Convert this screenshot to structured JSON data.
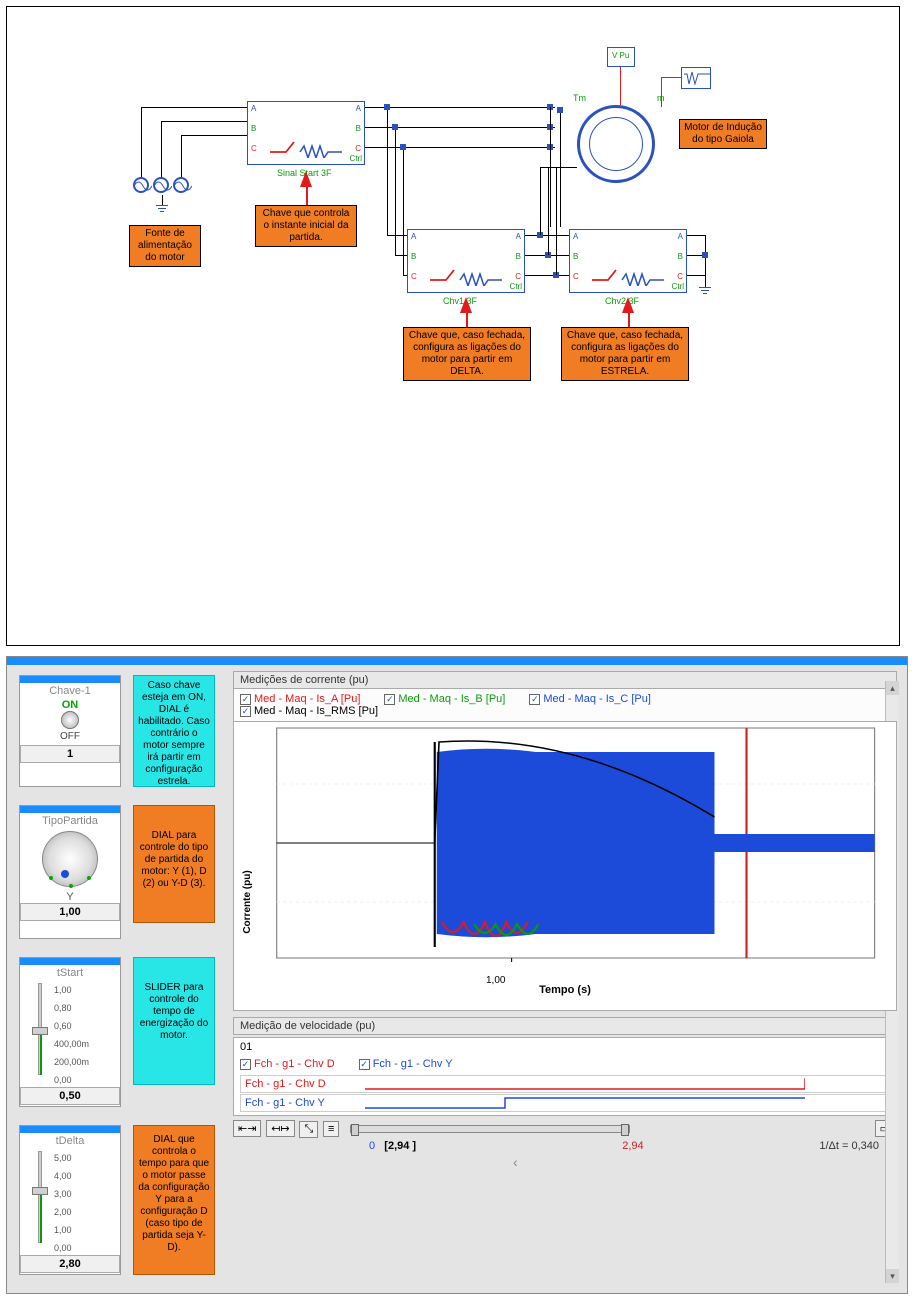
{
  "top_figure": {
    "notes": {
      "fonte": "Fonte de alimentação do motor",
      "chave": "Chave que controla o instante inicial da partida.",
      "delta": "Chave que, caso fechada, configura as ligações do motor para partir em DELTA.",
      "estrela": "Chave que, caso fechada, configura as ligações do motor para partir em ESTRELA.",
      "motor": "Motor de Indução do tipo Gaiola"
    },
    "labels": {
      "sinal_start": "Sinal Start 3F",
      "chv1": "Chv1 3F",
      "chv2": "Chv2 3F",
      "ctrl": "Ctrl",
      "portA": "A",
      "portB": "B",
      "portC": "C",
      "tm": "Tm",
      "m": "m",
      "scope_block": "V Pu"
    }
  },
  "controls": {
    "chave1": {
      "title": "Chave-1",
      "on": "ON",
      "off": "OFF",
      "value": "1"
    },
    "tipo": {
      "title": "TipoPartida",
      "letter": "Y",
      "value": "1,00"
    },
    "tstart": {
      "title": "tStart",
      "ticks": [
        "1,00",
        "0,80",
        "0,60",
        "400,00m",
        "200,00m",
        "0,00"
      ],
      "value": "0,50"
    },
    "tdelta": {
      "title": "tDelta",
      "ticks": [
        "5,00",
        "4,00",
        "3,00",
        "2,00",
        "1,00",
        "0,00"
      ],
      "value": "2,80"
    }
  },
  "info": {
    "i1": "Caso chave esteja em ON, DIAL é habilitado. Caso contrário o motor sempre irá partir em configuração estrela.",
    "i2": "DIAL para controle do tipo de partida do motor: Y (1), D (2) ou Y-D (3).",
    "i3": "SLIDER para controle do tempo de energização do motor.",
    "i4": "DIAL que controla o tempo para que o motor passe da configuração Y para a configuração D (caso tipo de partida seja Y-D)."
  },
  "plots": {
    "current": {
      "title": "Medições de corrente (pu)",
      "legend": [
        {
          "label": "Med - Maq - Is_A [Pu]",
          "cls": "leg-red"
        },
        {
          "label": "Med - Maq - Is_B [Pu]",
          "cls": "leg-grn"
        },
        {
          "label": "Med - Maq - Is_C [Pu]",
          "cls": "leg-blu"
        },
        {
          "label": "Med - Maq - Is_RMS [Pu]",
          "cls": "leg-blk"
        }
      ],
      "ylabel": "Corrente (pu)",
      "xlabel": "Tempo (s)",
      "xtick": "1,00"
    },
    "speed_title": "Medição de velocidade (pu)",
    "digital": {
      "title": "01",
      "legend": [
        {
          "label": "Fch - g1 - Chv D",
          "cls": "leg-red"
        },
        {
          "label": "Fch - g1 - Chv Y",
          "cls": "leg-blu"
        }
      ],
      "rows": [
        {
          "label": "Fch - g1 - Chv D",
          "cls": "leg-red"
        },
        {
          "label": "Fch - g1 - Chv Y",
          "cls": "leg-blu"
        }
      ]
    },
    "time_axis": {
      "zero": "0",
      "cursor": "[2,94 ]",
      "marker": "2,94",
      "delta": "1/Δt = 0,340"
    },
    "nav": {
      "left": "‹",
      "right": "›"
    }
  },
  "chart_data": {
    "type": "line",
    "title": "Medições de corrente (pu)",
    "xlabel": "Tempo (s)",
    "ylabel": "Corrente (pu)",
    "xlim": [
      0,
      3.0
    ],
    "ylim": [
      -8,
      8
    ],
    "cursor_x": 2.94,
    "note": "Three-phase motor start; Is_A/B/C oscillate with large amplitude from t≈0.50 to t≈1.80 (~±7 pu peak decaying) then settle to ~±1 pu steady state; Is_RMS black envelope tracks magnitude",
    "series": [
      {
        "name": "Is_A",
        "color": "red"
      },
      {
        "name": "Is_B",
        "color": "green"
      },
      {
        "name": "Is_C",
        "color": "blue"
      },
      {
        "name": "Is_RMS",
        "color": "black"
      }
    ]
  }
}
